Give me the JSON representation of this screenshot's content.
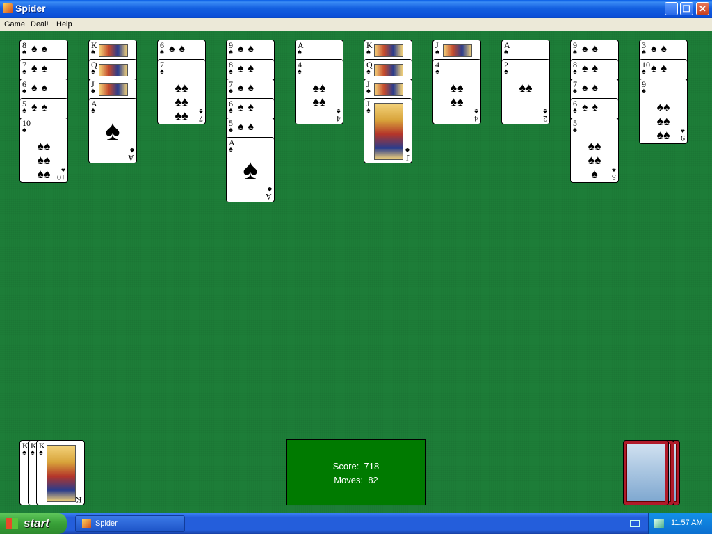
{
  "window": {
    "title": "Spider",
    "buttons": {
      "minimize": "_",
      "maximize": "❐",
      "close": "✕"
    }
  },
  "menu": [
    "Game",
    "Deal!",
    "Help"
  ],
  "game": {
    "score_label": "Score:",
    "score": "718",
    "moves_label": "Moves:",
    "moves": "82"
  },
  "columns": [
    {
      "cards": [
        "8",
        "7",
        "6",
        "5",
        "10"
      ]
    },
    {
      "cards": [
        "K",
        "Q",
        "J",
        "A"
      ]
    },
    {
      "cards": [
        "6",
        "7"
      ]
    },
    {
      "cards": [
        "9",
        "8",
        "7",
        "6",
        "5",
        "A"
      ]
    },
    {
      "cards": [
        "A",
        "4"
      ]
    },
    {
      "cards": [
        "K",
        "Q",
        "J",
        "J"
      ]
    },
    {
      "cards": [
        "J",
        "4"
      ]
    },
    {
      "cards": [
        "A",
        "2"
      ]
    },
    {
      "cards": [
        "9",
        "8",
        "7",
        "6",
        "5"
      ]
    },
    {
      "cards": [
        "3",
        "10",
        "9"
      ]
    }
  ],
  "suit_symbol": "♠",
  "completed_suits": [
    "K",
    "K",
    "K"
  ],
  "stock_piles_remaining": 3,
  "taskbar": {
    "start_label": "start",
    "task_label": "Spider",
    "clock": "11:57 AM"
  },
  "colors": {
    "felt": "#1d7d38",
    "score_box": "#007a00",
    "card_back": "#b01a2a"
  }
}
